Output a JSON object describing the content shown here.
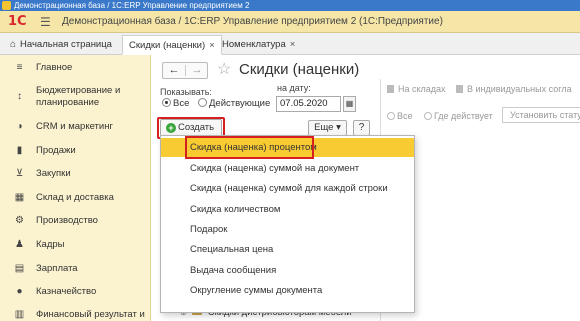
{
  "window": {
    "title": "Демонстрационная база / 1С:ERP Управление предприятием 2"
  },
  "header": {
    "logo": "1С",
    "title": "Демонстрационная база / 1С:ERP Управление предприятием 2  (1С:Предприятие)"
  },
  "tabs": [
    {
      "label": "Начальная страница"
    },
    {
      "label": "Скидки (наценки)",
      "close": "×"
    },
    {
      "label": "Номенклатура",
      "close": "×"
    }
  ],
  "sidebar": {
    "items": [
      {
        "label": "Главное",
        "icon": "menu-icon"
      },
      {
        "label": "Бюджетирование и",
        "label2": "планирование",
        "icon": "budget-icon"
      },
      {
        "label": "CRM и маркетинг",
        "icon": "crm-icon"
      },
      {
        "label": "Продажи",
        "icon": "sales-icon"
      },
      {
        "label": "Закупки",
        "icon": "cart-icon"
      },
      {
        "label": "Склад и доставка",
        "icon": "warehouse-icon"
      },
      {
        "label": "Производство",
        "icon": "factory-icon"
      },
      {
        "label": "Кадры",
        "icon": "people-icon"
      },
      {
        "label": "Зарплата",
        "icon": "salary-icon"
      },
      {
        "label": "Казначейство",
        "icon": "treasury-icon"
      },
      {
        "label": "Финансовый результат и",
        "icon": "finance-icon"
      }
    ]
  },
  "form": {
    "title": "Скидки (наценки)",
    "show_label": "Показывать:",
    "date_label": "на дату:",
    "radio_all": "Все",
    "radio_active": "Действующие",
    "date_value": "07.05.2020",
    "create_label": "Создать",
    "more_label": "Еще",
    "help_label": "?",
    "right": {
      "tab1": "На складах",
      "tab2": "В индивидуальных согла",
      "radio_all": "Все",
      "radio_where": "Где действует",
      "button": "Установить стату"
    },
    "tree_row": "Скидки дистрибьюторам мебели"
  },
  "dropdown": {
    "items": [
      "Скидка (наценка) процентом",
      "Скидка (наценка) суммой на документ",
      "Скидка (наценка) суммой для каждой строки",
      "Скидка количеством",
      "Подарок",
      "Специальная цена",
      "Выдача сообщения",
      "Округление суммы документа"
    ],
    "highlighted_index": 0
  },
  "colors": {
    "accent": "#f8cb32",
    "highlight_box": "#d62020",
    "sidebar_bg": "#fbf3cf",
    "header_bg": "#f5e6a8"
  }
}
